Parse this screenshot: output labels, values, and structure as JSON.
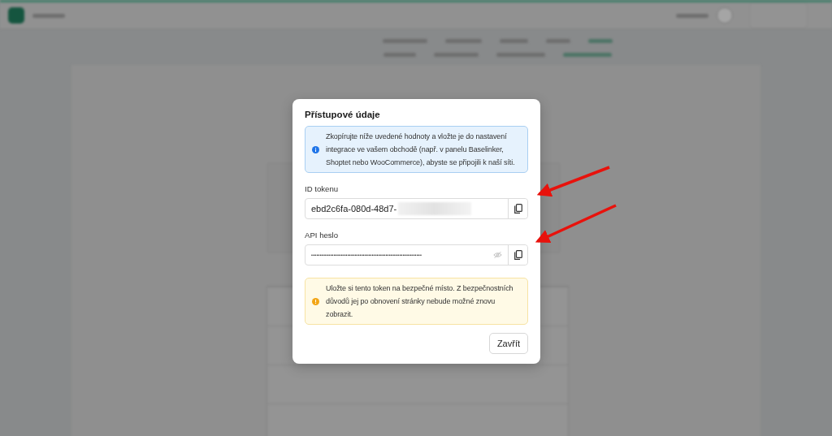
{
  "dialog": {
    "title": "Přístupové údaje",
    "info": "Zkopírujte níže uvedené hodnoty a vložte je do nastavení integrace ve vašem obchodě (např. v panelu Baselinker, Shoptet nebo WooCommerce), abyste se připojili k naší síti.",
    "fields": [
      {
        "label": "ID tokenu",
        "value": "ebd2c6fa-080d-48d7-",
        "kind": "text",
        "redacted": true
      },
      {
        "label": "API heslo",
        "value": "••••••••••••••••••••••••••••••••••••••••••••••••••••••••••••••••",
        "kind": "password",
        "redacted": false
      }
    ],
    "warning": "Uložte si tento token na bezpečné místo. Z bezpečnostních důvodů jej po obnovení stránky nebude možné znovu zobrazit.",
    "close_button": "Zavřít"
  }
}
